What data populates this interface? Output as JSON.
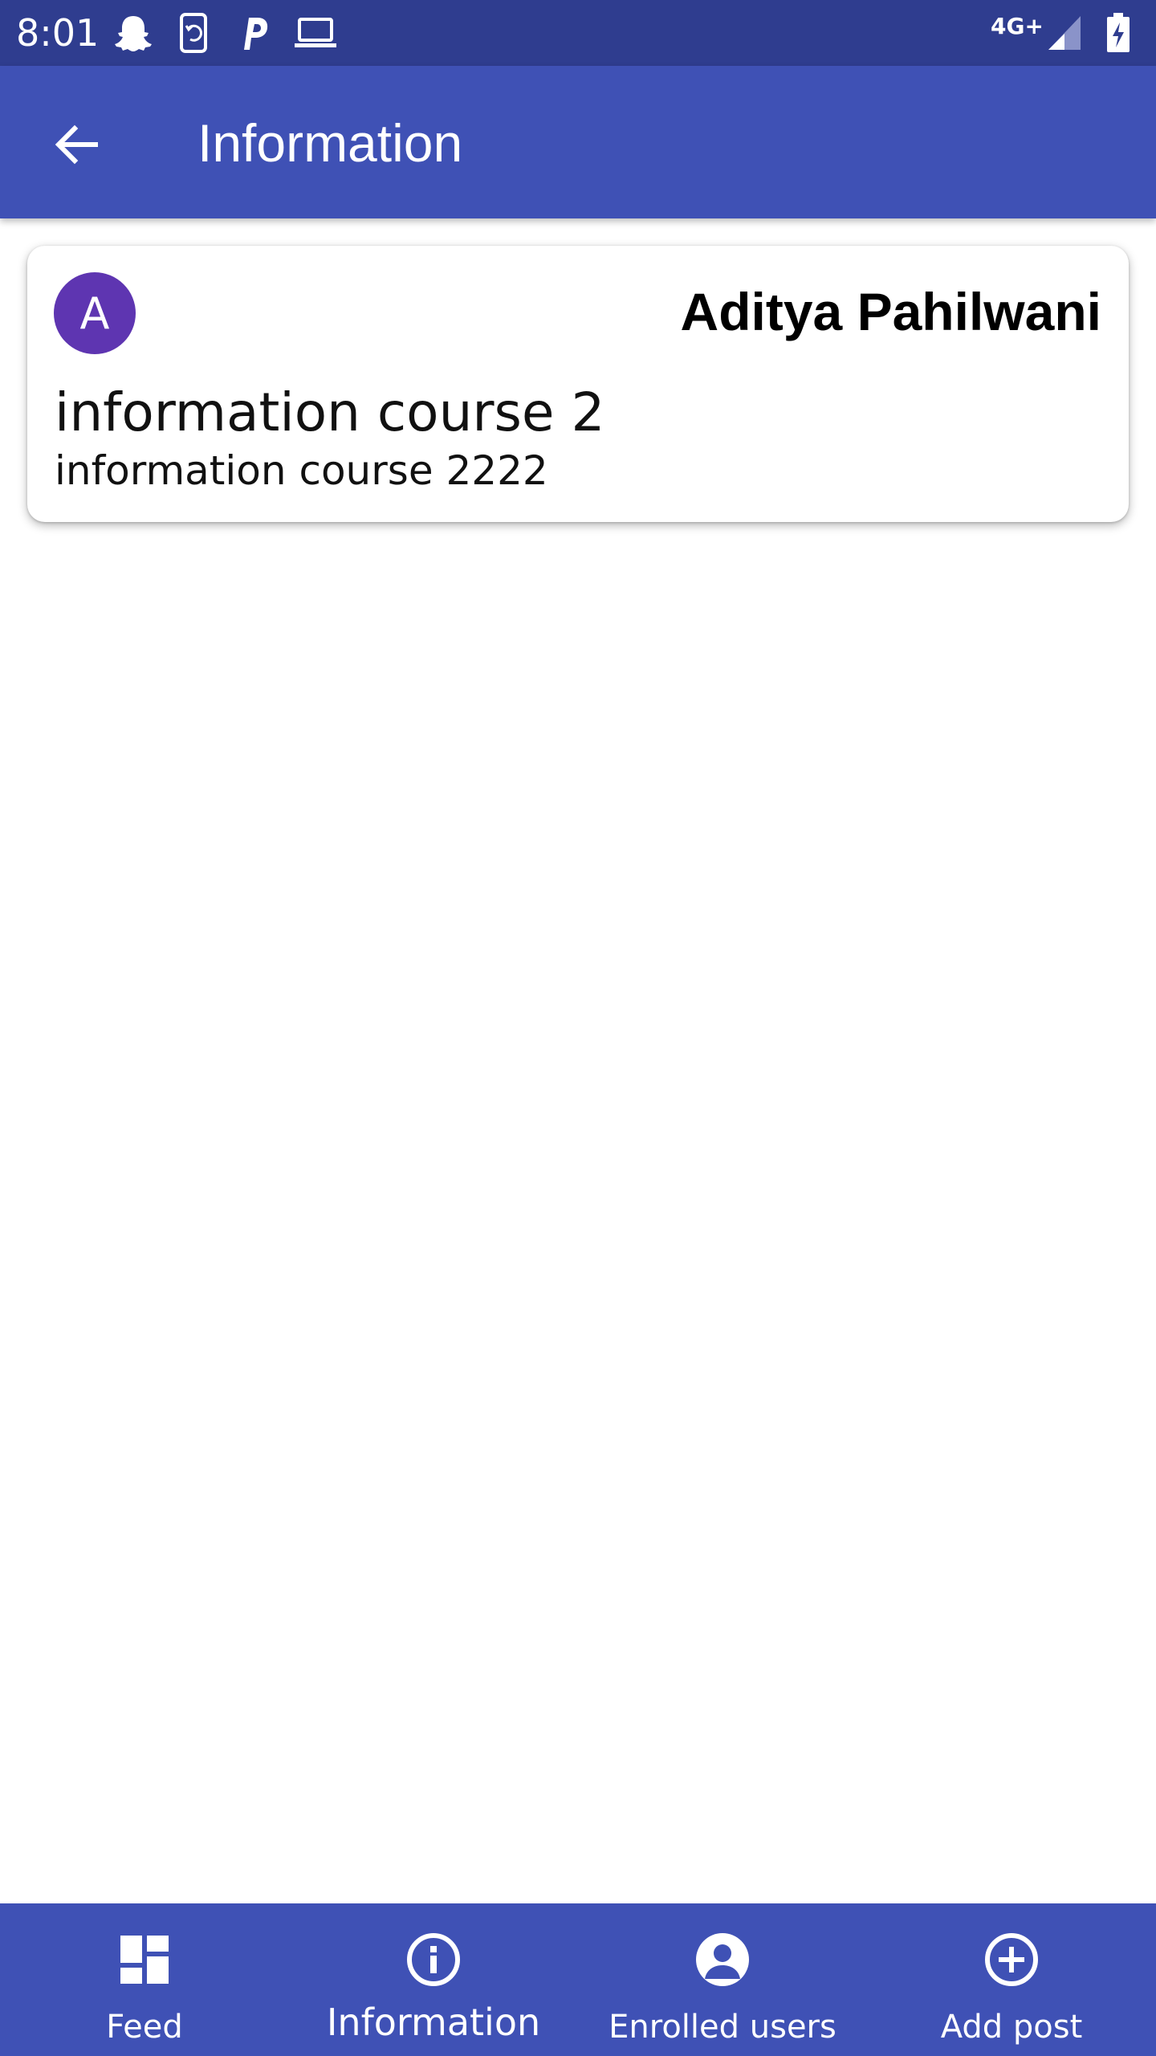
{
  "status_bar": {
    "time": "8:01",
    "network": "4G+",
    "icons": [
      "snapchat-icon",
      "phone-sync-icon",
      "parking-icon",
      "laptop-icon",
      "signal-icon",
      "battery-charging-icon"
    ]
  },
  "app_bar": {
    "title": "Information",
    "back_icon": "arrow-back-icon"
  },
  "card": {
    "avatar_letter": "A",
    "author": "Aditya Pahilwani",
    "title": "information course 2",
    "body": "information course 2222"
  },
  "bottom_nav": {
    "items": [
      {
        "label": "Feed",
        "icon": "dashboard-icon"
      },
      {
        "label": "Information",
        "icon": "info-icon",
        "active": true
      },
      {
        "label": "Enrolled users",
        "icon": "account-circle-icon"
      },
      {
        "label": "Add post",
        "icon": "add-circle-icon"
      }
    ]
  },
  "colors": {
    "status_bar": "#2f3d8f",
    "primary": "#3f51b5",
    "avatar": "#5e35b1",
    "background": "#ffffff"
  }
}
